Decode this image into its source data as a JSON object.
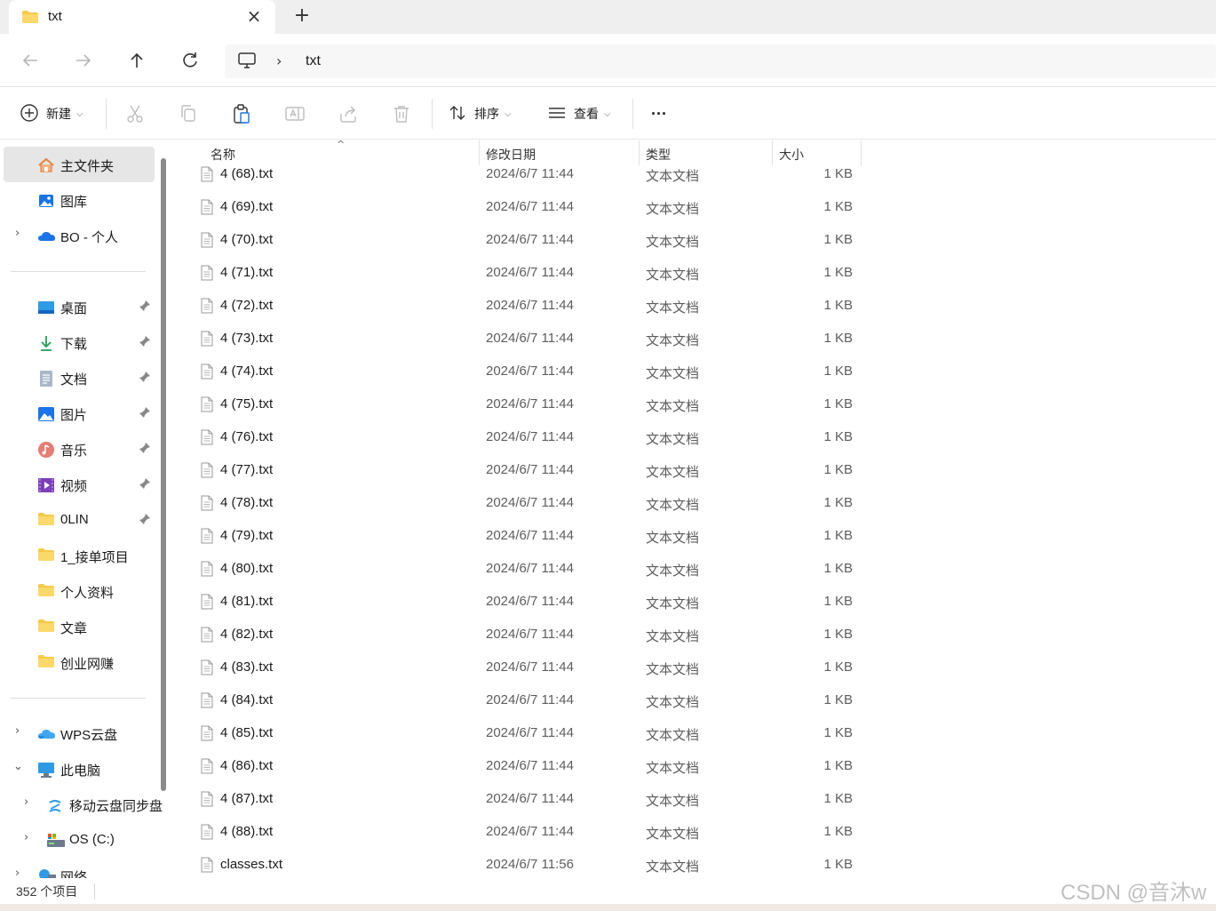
{
  "tab": {
    "title": "txt",
    "close_glyph": "×",
    "new_tab_glyph": "+"
  },
  "address": {
    "chevron": "›",
    "path": "txt"
  },
  "toolbar": {
    "new_label": "新建",
    "sort_label": "排序",
    "view_label": "查看",
    "more_glyph": "···",
    "dropdown_glyph": "⌵"
  },
  "sidebar": {
    "top_items": [
      {
        "label": "主文件夹",
        "icon": "home-icon"
      },
      {
        "label": "图库",
        "icon": "gallery-icon"
      },
      {
        "label": "BO - 个人",
        "icon": "onedrive-icon"
      }
    ],
    "quick_access": [
      {
        "label": "桌面",
        "icon": "desktop-icon"
      },
      {
        "label": "下载",
        "icon": "download-icon"
      },
      {
        "label": "文档",
        "icon": "documents-icon"
      },
      {
        "label": "图片",
        "icon": "pictures-icon"
      },
      {
        "label": "音乐",
        "icon": "music-icon"
      },
      {
        "label": "视频",
        "icon": "videos-icon"
      },
      {
        "label": "0LIN",
        "icon": "folder-icon"
      },
      {
        "label": "1_接单项目",
        "icon": "folder-icon"
      },
      {
        "label": "个人资料",
        "icon": "folder-icon"
      },
      {
        "label": "文章",
        "icon": "folder-icon"
      },
      {
        "label": "创业网赚",
        "icon": "folder-icon"
      }
    ],
    "bottom_items": [
      {
        "label": "WPS云盘",
        "icon": "wps-cloud-icon"
      },
      {
        "label": "此电脑",
        "icon": "this-pc-icon"
      },
      {
        "label": "移动云盘同步盘",
        "icon": "mobile-cloud-icon"
      },
      {
        "label": "OS (C:)",
        "icon": "drive-icon"
      },
      {
        "label": "网络",
        "icon": "network-icon"
      }
    ],
    "expand_collapsed": "›",
    "expand_open": "⌄"
  },
  "columns": {
    "name": "名称",
    "date": "修改日期",
    "type": "类型",
    "size": "大小",
    "sort_caret": "^"
  },
  "files": [
    {
      "name": "4 (68).txt",
      "date": "2024/6/7 11:44",
      "type": "文本文档",
      "size": "1 KB"
    },
    {
      "name": "4 (69).txt",
      "date": "2024/6/7 11:44",
      "type": "文本文档",
      "size": "1 KB"
    },
    {
      "name": "4 (70).txt",
      "date": "2024/6/7 11:44",
      "type": "文本文档",
      "size": "1 KB"
    },
    {
      "name": "4 (71).txt",
      "date": "2024/6/7 11:44",
      "type": "文本文档",
      "size": "1 KB"
    },
    {
      "name": "4 (72).txt",
      "date": "2024/6/7 11:44",
      "type": "文本文档",
      "size": "1 KB"
    },
    {
      "name": "4 (73).txt",
      "date": "2024/6/7 11:44",
      "type": "文本文档",
      "size": "1 KB"
    },
    {
      "name": "4 (74).txt",
      "date": "2024/6/7 11:44",
      "type": "文本文档",
      "size": "1 KB"
    },
    {
      "name": "4 (75).txt",
      "date": "2024/6/7 11:44",
      "type": "文本文档",
      "size": "1 KB"
    },
    {
      "name": "4 (76).txt",
      "date": "2024/6/7 11:44",
      "type": "文本文档",
      "size": "1 KB"
    },
    {
      "name": "4 (77).txt",
      "date": "2024/6/7 11:44",
      "type": "文本文档",
      "size": "1 KB"
    },
    {
      "name": "4 (78).txt",
      "date": "2024/6/7 11:44",
      "type": "文本文档",
      "size": "1 KB"
    },
    {
      "name": "4 (79).txt",
      "date": "2024/6/7 11:44",
      "type": "文本文档",
      "size": "1 KB"
    },
    {
      "name": "4 (80).txt",
      "date": "2024/6/7 11:44",
      "type": "文本文档",
      "size": "1 KB"
    },
    {
      "name": "4 (81).txt",
      "date": "2024/6/7 11:44",
      "type": "文本文档",
      "size": "1 KB"
    },
    {
      "name": "4 (82).txt",
      "date": "2024/6/7 11:44",
      "type": "文本文档",
      "size": "1 KB"
    },
    {
      "name": "4 (83).txt",
      "date": "2024/6/7 11:44",
      "type": "文本文档",
      "size": "1 KB"
    },
    {
      "name": "4 (84).txt",
      "date": "2024/6/7 11:44",
      "type": "文本文档",
      "size": "1 KB"
    },
    {
      "name": "4 (85).txt",
      "date": "2024/6/7 11:44",
      "type": "文本文档",
      "size": "1 KB"
    },
    {
      "name": "4 (86).txt",
      "date": "2024/6/7 11:44",
      "type": "文本文档",
      "size": "1 KB"
    },
    {
      "name": "4 (87).txt",
      "date": "2024/6/7 11:44",
      "type": "文本文档",
      "size": "1 KB"
    },
    {
      "name": "4 (88).txt",
      "date": "2024/6/7 11:44",
      "type": "文本文档",
      "size": "1 KB"
    },
    {
      "name": "classes.txt",
      "date": "2024/6/7 11:56",
      "type": "文本文档",
      "size": "1 KB"
    }
  ],
  "status": {
    "item_count": "352 个项目"
  },
  "watermark": "CSDN @音沐w",
  "colors": {
    "folder_yellow": "#f7c948",
    "selected_bg": "#e6e6e6",
    "accent_blue": "#1a73e8",
    "home_orange": "#e8833a"
  }
}
